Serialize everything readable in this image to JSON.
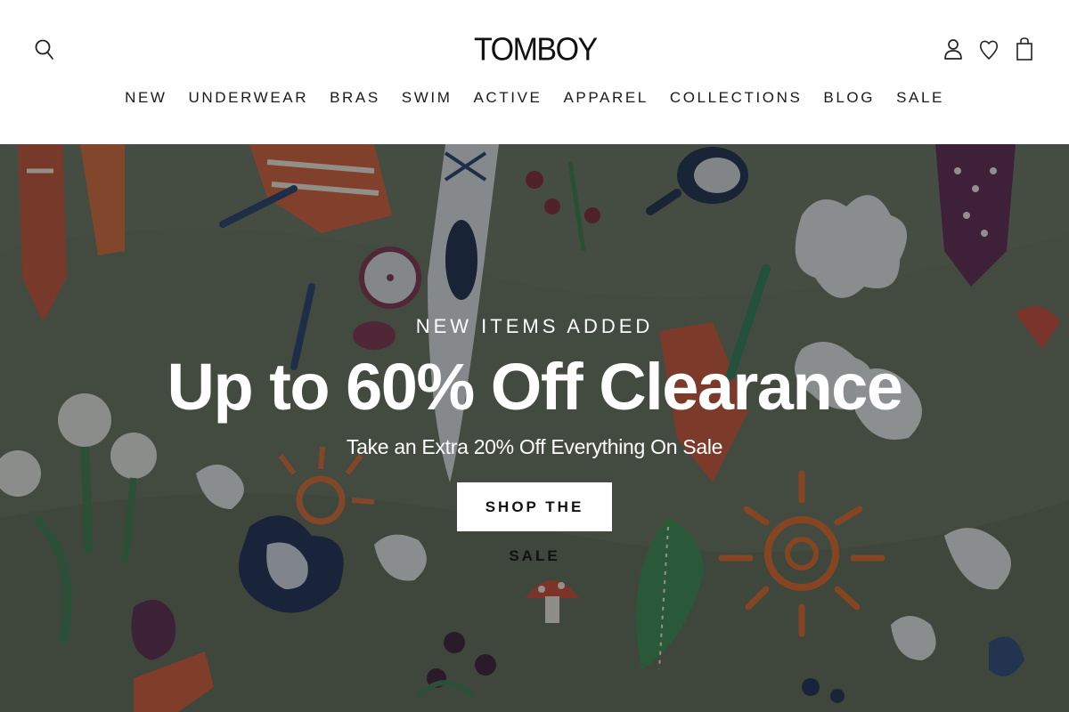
{
  "header": {
    "logo_text": "TOMBOY",
    "icons": {
      "search": "search-icon",
      "account": "user-icon",
      "wishlist": "heart-icon",
      "cart": "shopping-bag-icon"
    }
  },
  "nav": {
    "items": [
      {
        "label": "NEW"
      },
      {
        "label": "UNDERWEAR"
      },
      {
        "label": "BRAS"
      },
      {
        "label": "SWIM"
      },
      {
        "label": "ACTIVE"
      },
      {
        "label": "APPAREL"
      },
      {
        "label": "COLLECTIONS"
      },
      {
        "label": "BLOG"
      },
      {
        "label": "SALE"
      }
    ]
  },
  "hero": {
    "eyebrow": "NEW ITEMS ADDED",
    "title": "Up to 60% Off Clearance",
    "subtitle": "Take an Extra 20% Off Everything On Sale",
    "cta_label": "SHOP THE SALE"
  },
  "colors": {
    "header_bg": "#ffffff",
    "text_dark": "#111111",
    "hero_bg": "#5f6a5b",
    "cta_bg": "#ffffff"
  }
}
